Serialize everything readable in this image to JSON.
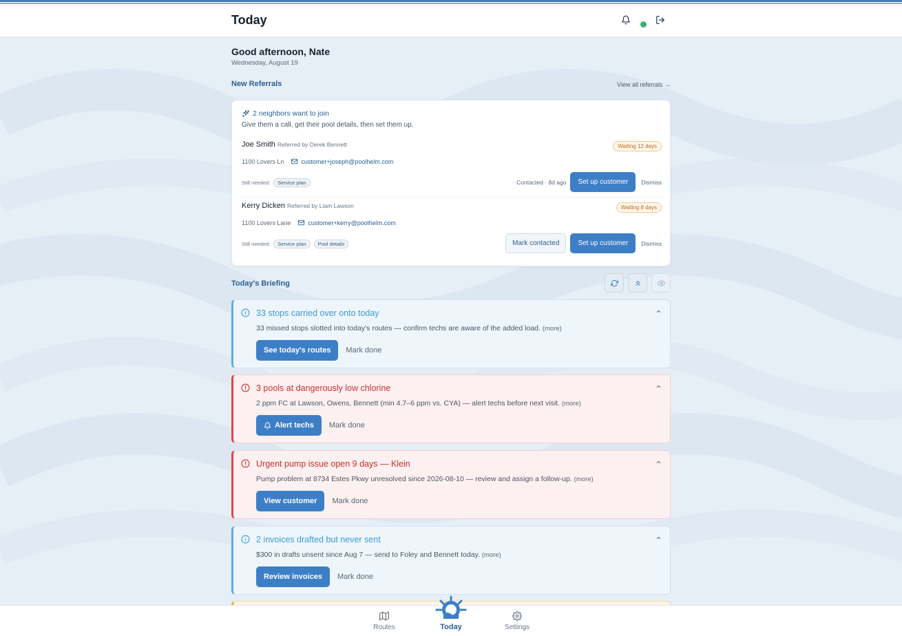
{
  "header": {
    "title": "Today"
  },
  "greeting": {
    "text": "Good afternoon, Nate",
    "date": "Wednesday, August 19"
  },
  "referrals": {
    "section_title": "New Referrals",
    "view_all": "View all referrals →",
    "headline": "2 neighbors want to join",
    "subtitle": "Give them a call, get their pool details, then set them up.",
    "still_needed_label": "Still needed:",
    "items": [
      {
        "name": "Joe Smith",
        "referred_by": "Referred by Derek Bennett",
        "waiting": "Waiting 12 days",
        "address": "1100 Lovers Ln",
        "email": "customer+joseph@poolhelm.com",
        "needed": [
          "Service plan"
        ],
        "contacted": "Contacted · 8d ago",
        "setup_label": "Set up customer",
        "dismiss_label": "Dismiss"
      },
      {
        "name": "Kerry Dicken",
        "referred_by": "Referred by Liam Lawson",
        "waiting": "Waiting 8 days",
        "address": "1100 Lovers Lane",
        "email": "customer+kerry@poolhelm.com",
        "needed": [
          "Service plan",
          "Pool details"
        ],
        "mark_contacted_label": "Mark contacted",
        "setup_label": "Set up customer",
        "dismiss_label": "Dismiss"
      }
    ]
  },
  "briefing": {
    "section_title": "Today's Briefing",
    "more_label": "(more)",
    "mark_done_label": "Mark done",
    "cards": [
      {
        "severity": "info",
        "title": "33 stops carried over onto today",
        "description": "33 missed stops slotted into today's routes — confirm techs are aware of the added load.",
        "action": "See today's routes"
      },
      {
        "severity": "danger",
        "title": "3 pools at dangerously low chlorine",
        "description": "2 ppm FC at Lawson, Owens, Bennett (min 4.7–6 ppm vs. CYA) — alert techs before next visit.",
        "action": "Alert techs",
        "action_icon": "bell-icon"
      },
      {
        "severity": "danger",
        "title": "Urgent pump issue open 9 days — Klein",
        "description": "Pump problem at 8734 Estes Pkwy unresolved since 2026-08-10 — review and assign a follow-up.",
        "action": "View customer"
      },
      {
        "severity": "info",
        "title": "2 invoices drafted but never sent",
        "description": "$300 in drafts unsent since Aug 7 — send to Foley and Bennett today.",
        "action": "Review invoices"
      }
    ]
  },
  "nav": {
    "routes": "Routes",
    "today": "Today",
    "settings": "Settings"
  },
  "colors": {
    "accent": "#3d7fc7",
    "info": "#5aaee0",
    "danger": "#d94848",
    "online": "#3fae6a",
    "warning": "#e8b23c"
  }
}
